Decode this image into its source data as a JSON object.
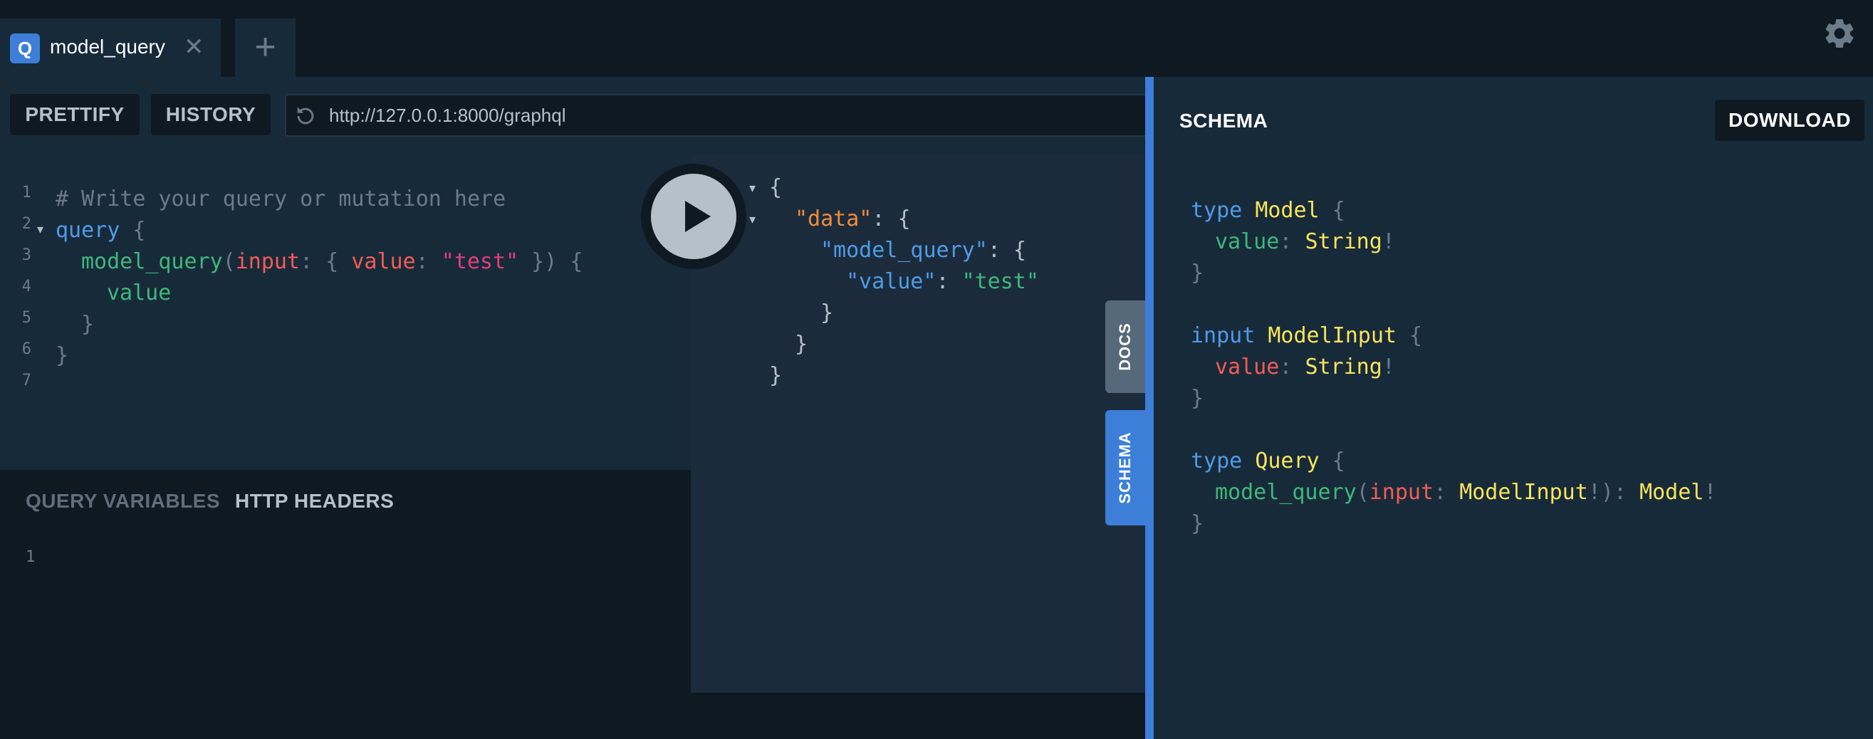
{
  "tab": {
    "badge": "Q",
    "title": "model_query",
    "close_symbol": "✕"
  },
  "add_tab_symbol": "+",
  "icons": {
    "settings": "gear-icon",
    "reload": "reload-icon",
    "run": "play-icon"
  },
  "colors": {
    "accent": "#3d7fd8",
    "background": "#0f1922",
    "panel": "#172a3a"
  },
  "toolbar": {
    "prettify_label": "PRETTIFY",
    "history_label": "HISTORY",
    "endpoint_url": "http://127.0.0.1:8000/graphql"
  },
  "query_editor": {
    "line_numbers": [
      "1",
      "2",
      "3",
      "4",
      "5",
      "6",
      "7"
    ],
    "comment": "# Write your query or mutation here",
    "op_keyword": "query",
    "field": "model_query",
    "arg_name": "input",
    "inner_key": "value",
    "arg_value": "\"test\"",
    "selection": "value"
  },
  "variables_panel": {
    "query_variables_label": "QUERY VARIABLES",
    "http_headers_label": "HTTP HEADERS",
    "line_number": "1"
  },
  "result": {
    "data_key": "\"data\"",
    "model_query_key": "\"model_query\"",
    "value_key": "\"value\"",
    "value": "\"test\""
  },
  "side_tabs": {
    "docs_label": "DOCS",
    "schema_label": "SCHEMA"
  },
  "schema_panel": {
    "title": "SCHEMA",
    "download_label": "DOWNLOAD",
    "kw_type": "type",
    "kw_input": "input",
    "model_name": "Model",
    "model_field": "value",
    "string_type": "String",
    "input_name": "ModelInput",
    "input_field": "value",
    "query_name": "Query",
    "query_field": "model_query",
    "query_arg": "input",
    "query_arg_type": "ModelInput",
    "query_return": "Model"
  }
}
